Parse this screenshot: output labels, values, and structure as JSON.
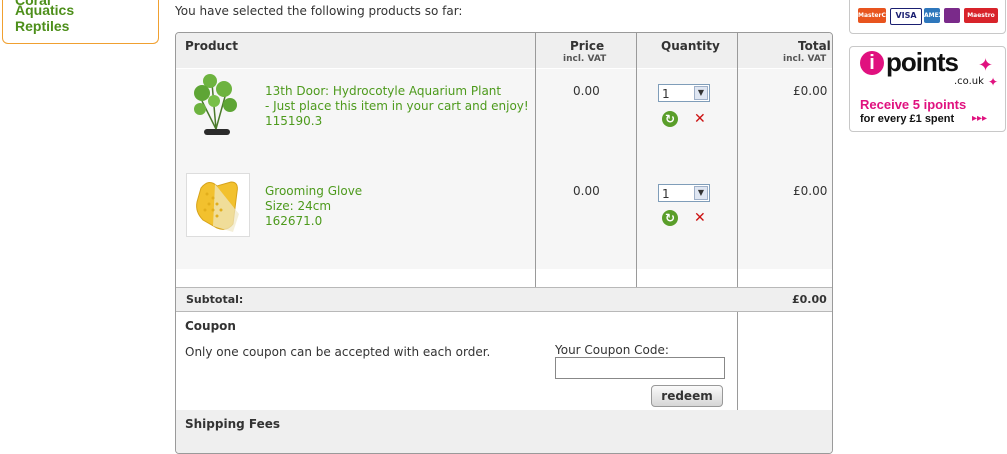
{
  "sidebar": {
    "partial_label": "Coral",
    "links": [
      "Aquatics",
      "Reptiles"
    ]
  },
  "intro_text": "You have selected the following products so far:",
  "cart": {
    "headers": {
      "product": "Product",
      "price": "Price",
      "price_sub": "incl. VAT",
      "quantity": "Quantity",
      "total": "Total",
      "total_sub": "incl. VAT"
    },
    "items": [
      {
        "line1": "13th Door: Hydrocotyle Aquarium Plant",
        "line2": "- Just place this item in your cart and enjoy!",
        "line3": "115190.3",
        "price": "0.00",
        "quantity": "1",
        "total": "£0.00"
      },
      {
        "line1": "Grooming Glove",
        "line2": "Size: 24cm",
        "line3": "162671.0",
        "price": "0.00",
        "quantity": "1",
        "total": "£0.00"
      }
    ],
    "subtotal_label": "Subtotal:",
    "subtotal_value": "£0.00",
    "coupon": {
      "title": "Coupon",
      "note": "Only one coupon can be accepted with each order.",
      "field_label": "Your Coupon Code:",
      "field_value": "",
      "button": "redeem"
    },
    "shipping_label": "Shipping Fees"
  },
  "payment_cards": [
    "MasterCard",
    "VISA",
    "AMEX",
    "Maestro"
  ],
  "ipoints": {
    "logo_i": "i",
    "logo_text": "points",
    "domain": ".co.uk",
    "headline": "Receive 5 ipoints",
    "subline": "for every £1 spent",
    "arrows": "▸▸▸"
  },
  "colors": {
    "link_green": "#4d9a1c",
    "sidebar_border": "#f0a030",
    "ipoints_pink": "#e0117f",
    "delete_red": "#cc1111"
  },
  "icons": {
    "refresh": "refresh-icon",
    "delete": "delete-icon",
    "dropdown": "chevron-down-icon"
  }
}
